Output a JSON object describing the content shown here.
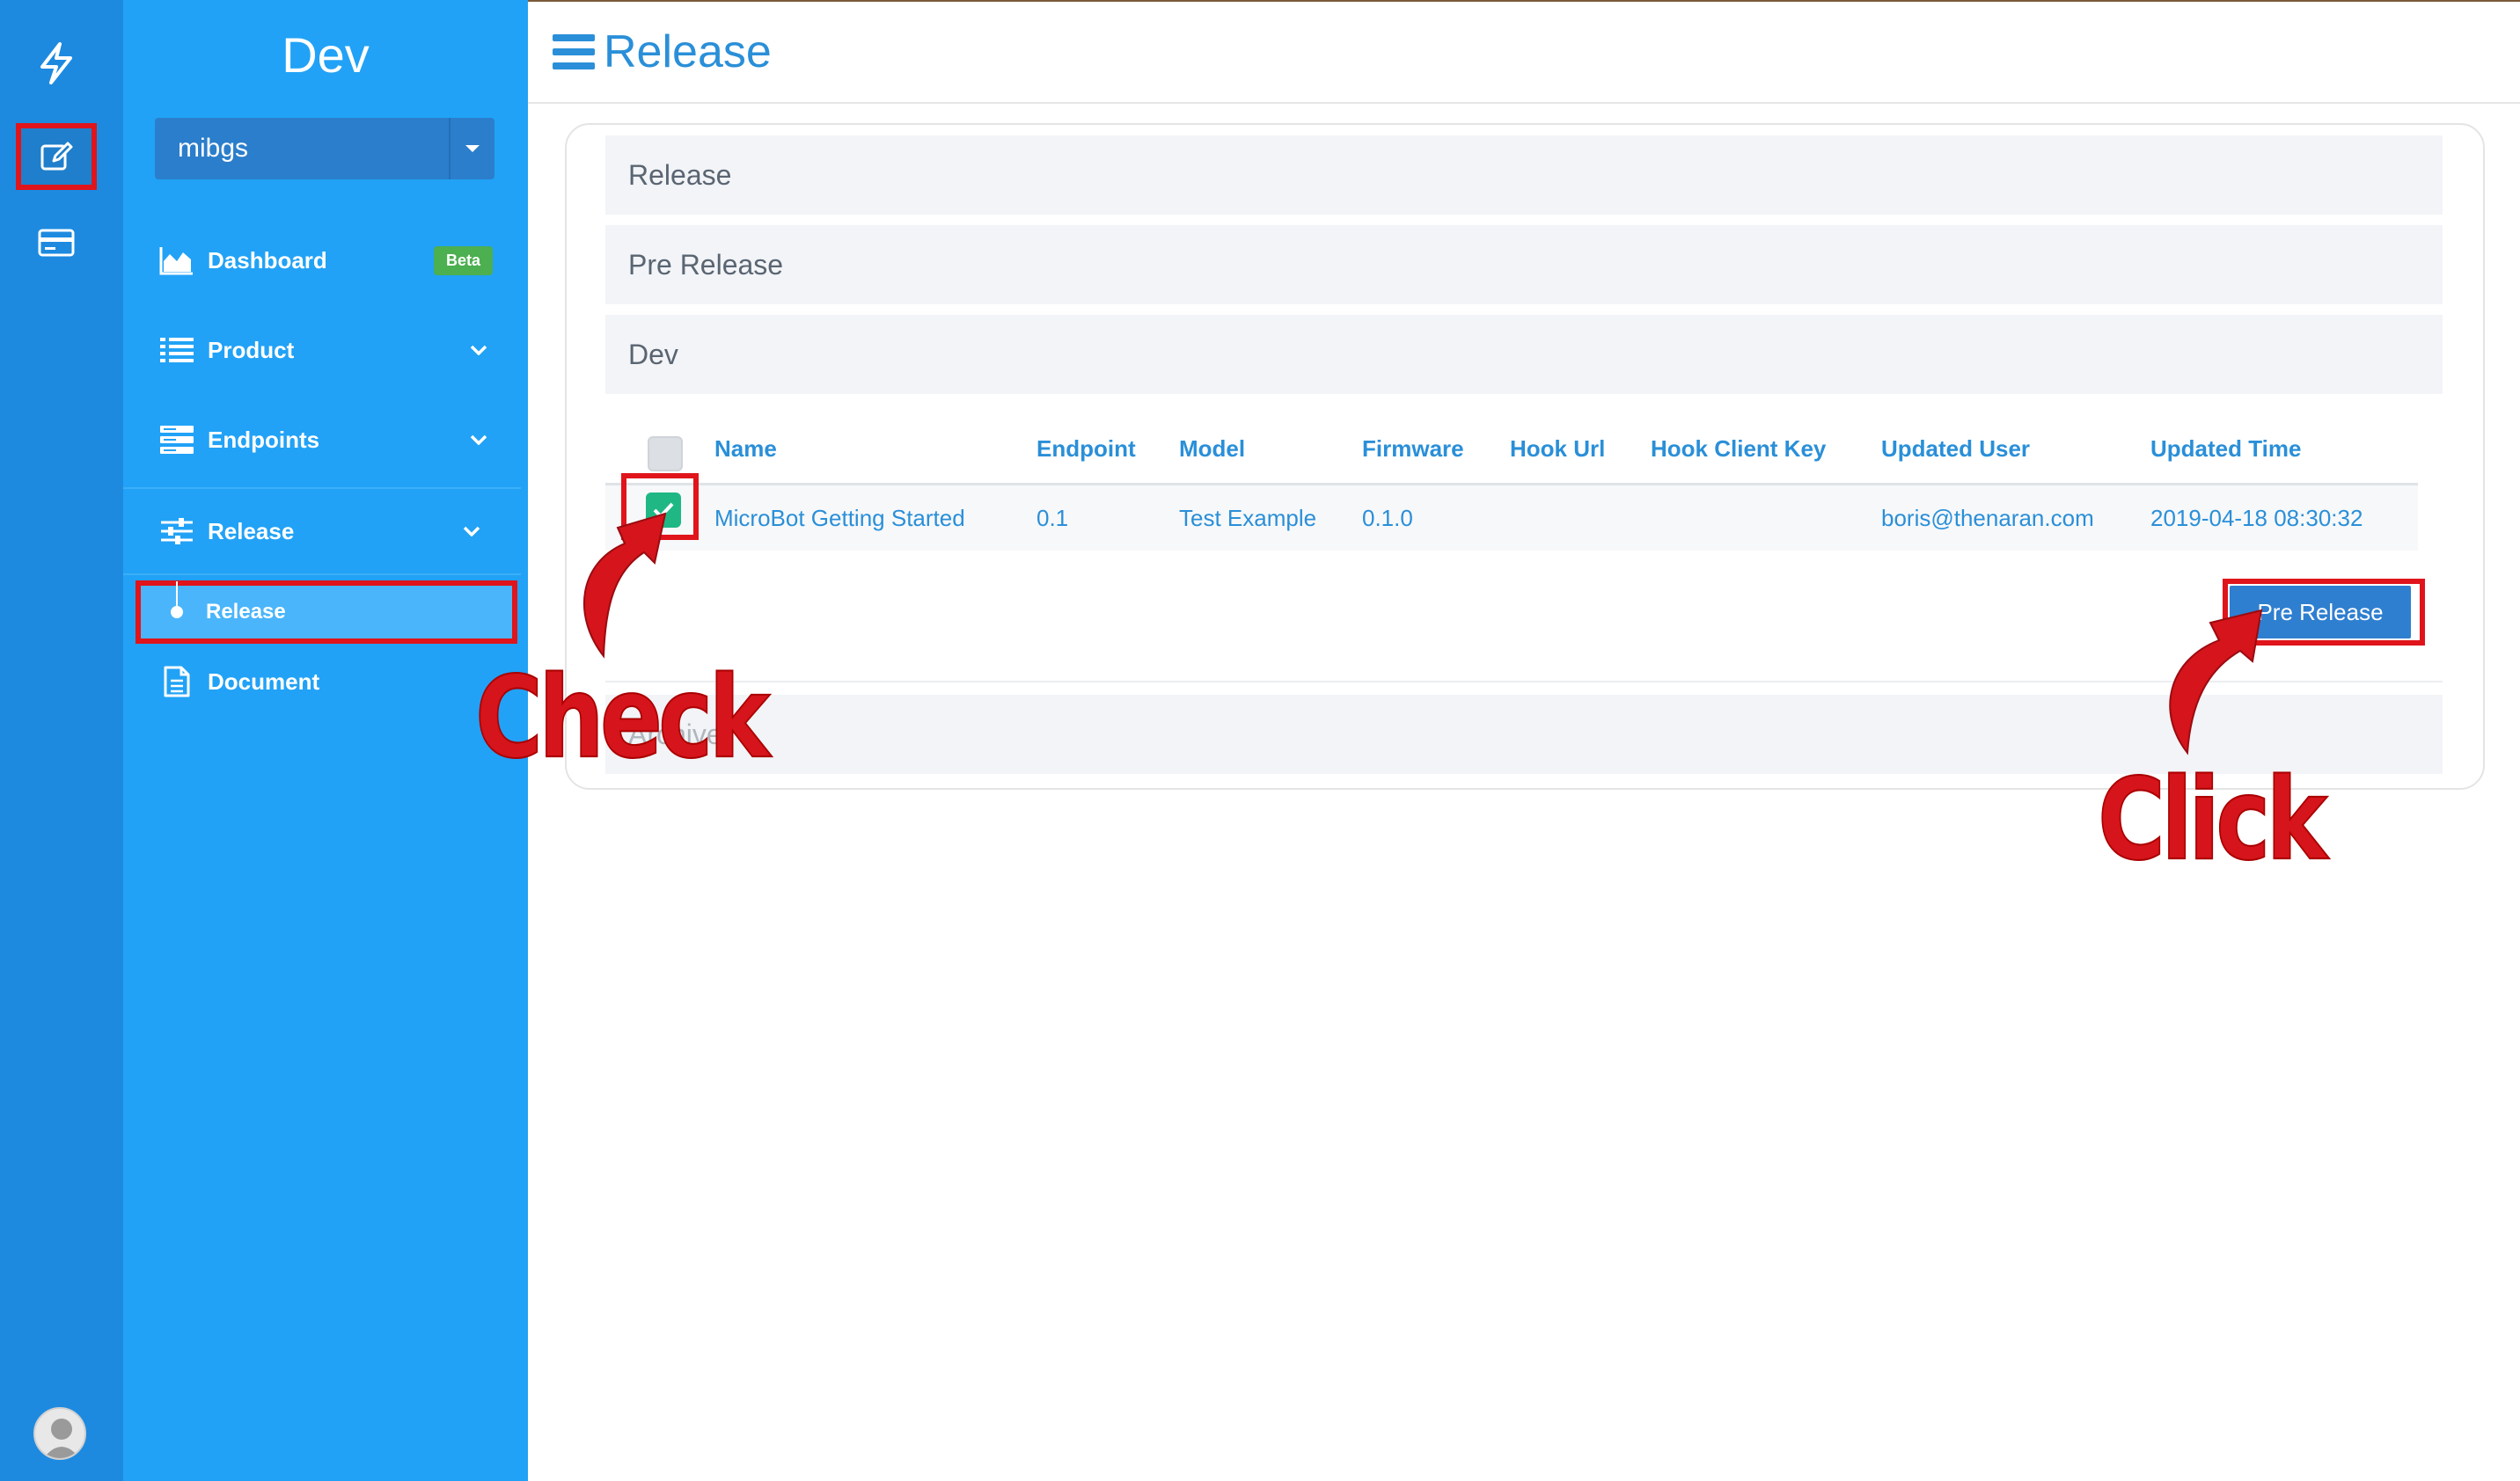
{
  "app": {
    "title": "Dev"
  },
  "org_select": {
    "value": "mibgs"
  },
  "nav": {
    "dashboard": {
      "label": "Dashboard",
      "badge": "Beta"
    },
    "product": {
      "label": "Product"
    },
    "endpoints": {
      "label": "Endpoints"
    },
    "release": {
      "label": "Release"
    },
    "sub_release": {
      "label": "Release"
    },
    "sub_document": {
      "label": "Document"
    }
  },
  "header": {
    "title": "Release"
  },
  "accordion": {
    "release": "Release",
    "prerelease": "Pre Release",
    "dev": "Dev",
    "archive": "Archive"
  },
  "table": {
    "columns": [
      "Name",
      "Endpoint",
      "Model",
      "Firmware",
      "Hook Url",
      "Hook Client Key",
      "Updated User",
      "Updated Time"
    ],
    "rows": [
      {
        "checked": true,
        "cells": [
          "MicroBot Getting Started",
          "0.1",
          "Test Example",
          "0.1.0",
          "",
          "",
          "boris@thenaran.com",
          "2019-04-18 08:30:32"
        ]
      }
    ]
  },
  "actions": {
    "prerelease_button": "Pre Release"
  },
  "annotations": {
    "check": "Check",
    "click": "Click"
  },
  "colors": {
    "rail": "#1d8ae0",
    "sidebar": "#21a2f6",
    "accent": "#2a8fd8",
    "highlight": "#e0141b",
    "checkbox_checked": "#1fb885",
    "button": "#2f7fd0"
  }
}
